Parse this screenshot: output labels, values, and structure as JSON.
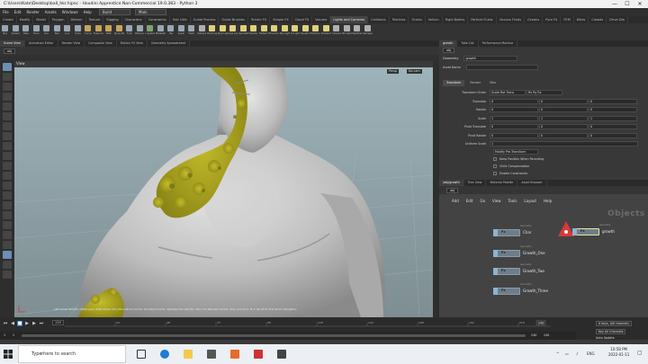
{
  "window": {
    "title": "C:\\Users\\Kate\\Desktop\\ball_hkr.hipnc - Houdini Apprentice Non-Commercial 19.0.383 - Python 3",
    "minimize": "—",
    "maximize": "☐",
    "close": "✕"
  },
  "menubar": {
    "items": [
      "File",
      "Edit",
      "Render",
      "Assets",
      "Windows",
      "Help"
    ],
    "desktop_select": "Build",
    "desktop_mode": "Main"
  },
  "shelf": {
    "tabs": [
      "Create",
      "Modify",
      "Model",
      "Polygon",
      "Deform",
      "Texture",
      "Rigging",
      "Characters",
      "Constraints",
      "Hair Utils",
      "Guide Process",
      "Guide Brushes",
      "Terrain FX",
      "Simple FX",
      "Cloud FX",
      "Volume",
      "Lights and Cameras",
      "Collisions",
      "Particles",
      "Grains",
      "Vellum",
      "Rigid Bodies",
      "Particle Fluids",
      "Viscous Fluids",
      "Oceans",
      "Pyro FX",
      "FEM",
      "Wires",
      "Crowds",
      "Drive Sim"
    ],
    "tools": [
      {
        "label": "Box",
        "color": "#9aa7b4"
      },
      {
        "label": "Sphere",
        "color": "#9aa7b4"
      },
      {
        "label": "Tube",
        "color": "#9aa7b4"
      },
      {
        "label": "Torus",
        "color": "#9aa7b4"
      },
      {
        "label": "Grid",
        "color": "#9aa7b4"
      },
      {
        "label": "Null",
        "color": "#9aa7b4"
      },
      {
        "label": "Line",
        "color": "#9aa7b4"
      },
      {
        "label": "Circle",
        "color": "#9aa7b4"
      },
      {
        "label": "Curve",
        "color": "#c7a45a"
      },
      {
        "label": "Draw Curve",
        "color": "#c7a45a"
      },
      {
        "label": "Path",
        "color": "#c7a45a"
      },
      {
        "label": "Spray Paint",
        "color": "#c7a45a"
      },
      {
        "label": "Font",
        "color": "#9aa7b4"
      },
      {
        "label": "Platonic",
        "color": "#9aa7b4"
      },
      {
        "label": "L-System",
        "color": "#7fa36f"
      },
      {
        "label": "Metaball",
        "color": "#9aa7b4"
      },
      {
        "label": "File",
        "color": "#9aa7b4"
      },
      {
        "label": "Spiral",
        "color": "#9aa7b4"
      },
      {
        "label": "Helix",
        "color": "#9aa7b4"
      },
      {
        "label": "Camera",
        "color": "#b0b0b0"
      },
      {
        "label": "Point Light",
        "color": "#e0d27a"
      },
      {
        "label": "Spot Light",
        "color": "#e0d27a"
      },
      {
        "label": "Area Light",
        "color": "#e0d27a"
      },
      {
        "label": "Geometry Light",
        "color": "#e0d27a"
      },
      {
        "label": "Volume Light",
        "color": "#e0d27a"
      },
      {
        "label": "Distant Light",
        "color": "#e0d27a"
      },
      {
        "label": "Environment Light",
        "color": "#e0d27a"
      },
      {
        "label": "Sky Light",
        "color": "#e0d27a"
      },
      {
        "label": "GI Light",
        "color": "#e0d27a"
      },
      {
        "label": "Caustic Light",
        "color": "#e0d27a"
      },
      {
        "label": "Portal Light",
        "color": "#e0d27a"
      },
      {
        "label": "Ambient Light",
        "color": "#e0d27a"
      },
      {
        "label": "Camera",
        "color": "#b0b0b0"
      },
      {
        "label": "VR Camera",
        "color": "#b0b0b0"
      },
      {
        "label": "Switcher",
        "color": "#b0b0b0"
      },
      {
        "label": "Gamepad Camera",
        "color": "#b0b0b0"
      }
    ]
  },
  "left_panes": [
    "Scene View",
    "Animation Editor",
    "Render View",
    "Composite View",
    "Motion FX View",
    "Geometry Spreadsheet"
  ],
  "right_panes": [
    "growth",
    "Take List",
    "Performance Monitor"
  ],
  "viewport": {
    "path": "obj",
    "label": "View",
    "persp": "Persp",
    "cam": "No cam",
    "status": "Left mouse tumbles. Middle pans. Right dollies. Ctrl+Alt+Left box-zooms. Ctrl+Right zooms. Spacebar-Ctrl-Left tilts. Hold L for alternate tumble, dolly, and zoom.    M or Alt+M for First Person Navigation."
  },
  "timeline": {
    "frame": "119",
    "ticks": [
      "24",
      "48",
      "72",
      "96",
      "120",
      "144",
      "168",
      "192",
      "216"
    ],
    "end_marker": "240",
    "range_start": "1",
    "range_start2": "1",
    "range_end": "240",
    "range_end2": "240",
    "keys_label": "0 keys, 0/0 channels",
    "key_all": "Key All Channels",
    "auto_update": "Auto Update"
  },
  "params": {
    "path": "obj",
    "node_type": "Geometry",
    "node_name": "growth",
    "asset_name_label": "Asset Name",
    "asset_name": "",
    "tabs": [
      "Transform",
      "Render",
      "Misc"
    ],
    "rows": [
      {
        "label": "Transform Order",
        "v": [
          "Scale Rot Trans",
          "Rx Ry Rz"
        ]
      },
      {
        "label": "Translate",
        "v": [
          "0",
          "0",
          "0"
        ]
      },
      {
        "label": "Rotate",
        "v": [
          "0",
          "0",
          "0"
        ]
      },
      {
        "label": "Scale",
        "v": [
          "1",
          "1",
          "1"
        ]
      },
      {
        "label": "Pivot Translate",
        "v": [
          "0",
          "0",
          "0"
        ]
      },
      {
        "label": "Pivot Rotate",
        "v": [
          "0",
          "0",
          "0"
        ]
      },
      {
        "label": "Uniform Scale",
        "v": [
          "1"
        ]
      }
    ],
    "modify_label": "Modify Pre-Transform",
    "checks": [
      "Keep Position When Parenting",
      "Child Compensation",
      "Enable Constraints"
    ]
  },
  "network": {
    "tabs": [
      "/obj/growth",
      "Tree View",
      "Material Palette",
      "Asset Browser"
    ],
    "path": "obj",
    "menu": [
      "Add",
      "Edit",
      "Go",
      "View",
      "Tools",
      "Layout",
      "Help"
    ],
    "context_label": "Objects",
    "nodes": [
      {
        "name": "Char",
        "type": "Geometry"
      },
      {
        "name": "growth",
        "type": "Geometry"
      },
      {
        "name": "Growth_One",
        "type": "Geometry"
      },
      {
        "name": "Growth_Two",
        "type": "Geometry"
      },
      {
        "name": "Growth_Three",
        "type": "Geometry"
      }
    ]
  },
  "taskbar": {
    "search_placeholder": "Type here to search",
    "time": "10:58 PM",
    "date": "2022-01-11",
    "lang": "ENG"
  }
}
